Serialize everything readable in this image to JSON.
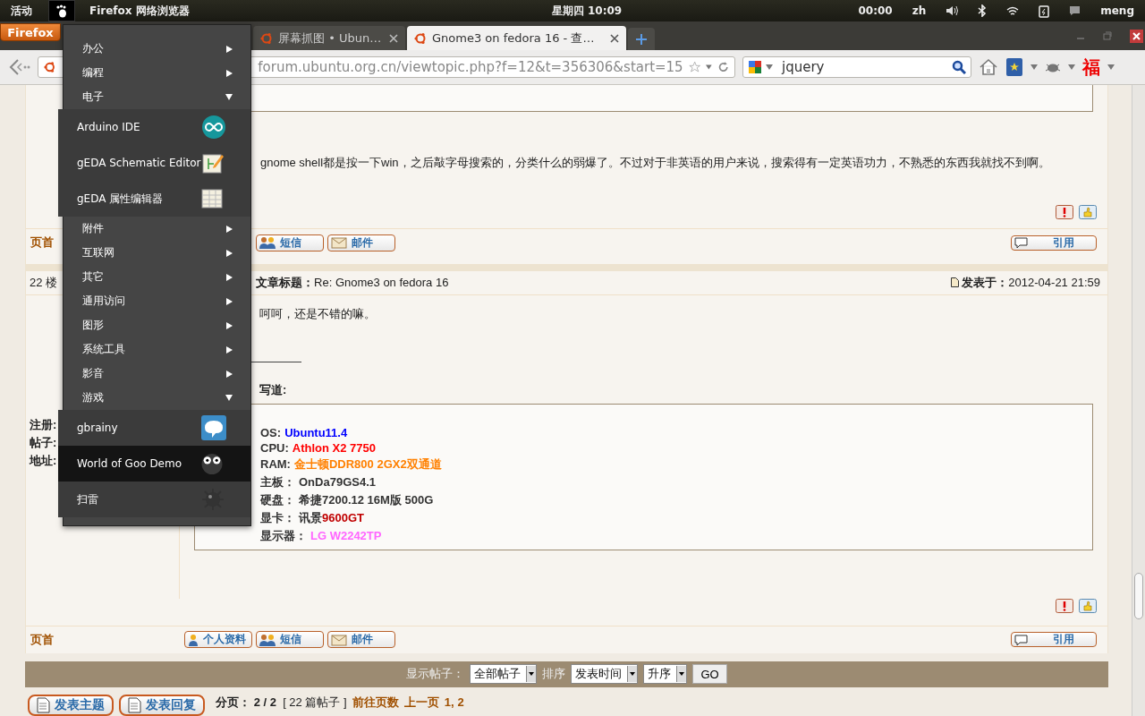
{
  "top_panel": {
    "activities": "活动",
    "app_name": "Firefox 网络浏览器",
    "clock": "星期四 10:09",
    "timer": "00:00",
    "language": "zh",
    "user": "meng"
  },
  "browser": {
    "menu_button": "Firefox",
    "tabs": [
      {
        "title": "屏幕抓图 • Ubun…",
        "selected": false
      },
      {
        "title": "Gnome3 on fedora 16 - 查…",
        "selected": true
      }
    ],
    "url": "forum.ubuntu.org.cn/viewtopic.php?f=12&t=356306&start=15",
    "search": "jquery",
    "addon_glyph": "福"
  },
  "app_menu": [
    {
      "kind": "category",
      "label": "办公",
      "expanded": false
    },
    {
      "kind": "category",
      "label": "编程",
      "expanded": false
    },
    {
      "kind": "category",
      "label": "电子",
      "expanded": true
    },
    {
      "kind": "app",
      "label": "Arduino IDE",
      "selected": false
    },
    {
      "kind": "app",
      "label": "gEDA Schematic Editor",
      "selected": false
    },
    {
      "kind": "app",
      "label": "gEDA 属性编辑器",
      "selected": false
    },
    {
      "kind": "category",
      "label": "附件",
      "expanded": false
    },
    {
      "kind": "category",
      "label": "互联网",
      "expanded": false
    },
    {
      "kind": "category",
      "label": "其它",
      "expanded": false
    },
    {
      "kind": "category",
      "label": "通用访问",
      "expanded": false
    },
    {
      "kind": "category",
      "label": "图形",
      "expanded": false
    },
    {
      "kind": "category",
      "label": "系统工具",
      "expanded": false
    },
    {
      "kind": "category",
      "label": "影音",
      "expanded": false
    },
    {
      "kind": "category",
      "label": "游戏",
      "expanded": true
    },
    {
      "kind": "app",
      "label": "gbrainy",
      "selected": false
    },
    {
      "kind": "app",
      "label": "World of Goo Demo",
      "selected": true
    },
    {
      "kind": "app",
      "label": "扫雷",
      "selected": false
    }
  ],
  "post_1": {
    "body": "gnome shell都是按一下win，之后敲字母搜索的，分类什么的弱爆了。不过对于非英语的用户来说，搜索得有一定英语功力，不熟悉的东西我就找不到啊。",
    "top_link": "页首",
    "buttons": [
      "短信",
      "邮件"
    ],
    "quote_button": "引用"
  },
  "post_2": {
    "floor": "22 楼",
    "subject_label": "文章标题：",
    "subject": "Re: Gnome3 on fedora 16",
    "posted_label": "发表于：",
    "posted": "2012-04-21 21:59",
    "user_labels": [
      "注册:",
      "帖子:",
      "地址:"
    ],
    "body": "呵呵，还是不错的嘛。",
    "quote_header": "写道:",
    "signature": [
      {
        "label": "OS:",
        "parts": [
          {
            "text": "Ubuntu11.4",
            "color": "#0000ff"
          }
        ]
      },
      {
        "label": "CPU:",
        "parts": [
          {
            "text": "Athlon X2 7750",
            "color": "#ff0000"
          }
        ]
      },
      {
        "label": "RAM:",
        "parts": [
          {
            "text": "金士顿DDR800 2GX2双通道",
            "color": "#ff8000"
          }
        ]
      },
      {
        "label": "主板：",
        "parts": [
          {
            "text": "OnDa79GS4.1",
            "color": "#333333"
          }
        ]
      },
      {
        "label": "硬盘：",
        "parts": [
          {
            "text": "希捷7200.12 16M版 500G",
            "color": "#333333"
          }
        ]
      },
      {
        "label": "显卡：",
        "parts": [
          {
            "text": "讯景",
            "color": "#333333"
          },
          {
            "text": "9600GT",
            "color": "#c00000"
          }
        ]
      },
      {
        "label": "显示器：",
        "parts": [
          {
            "text": "LG W2242TP",
            "color": "#ff66ff"
          }
        ]
      }
    ],
    "top_link": "页首",
    "buttons": [
      "个人资料",
      "短信",
      "邮件"
    ],
    "quote_button": "引用"
  },
  "display_bar": {
    "show_label": "显示帖子：",
    "show_value": "全部帖子",
    "sort_label": "排序",
    "sort_value": "发表时间",
    "order_value": "升序",
    "go": "GO"
  },
  "footer": {
    "new_topic": "发表主题",
    "reply": "发表回复",
    "pages_label": "分页：",
    "pages": "2 / 2",
    "count": "[ 22 篇帖子 ]",
    "goto": "前往页数",
    "prev": "上一页",
    "page_links": [
      "1,",
      "2"
    ]
  }
}
